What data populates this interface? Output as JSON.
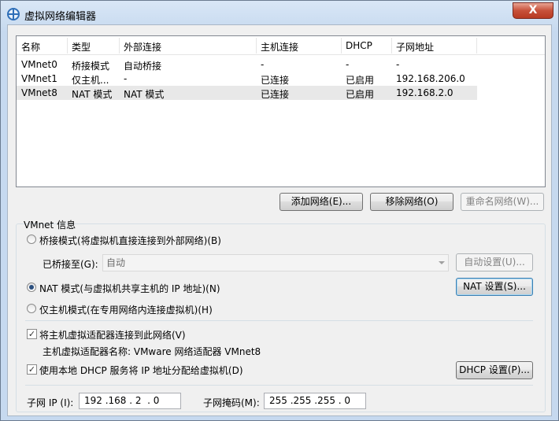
{
  "window": {
    "title": "虚拟网络编辑器",
    "close_label": "X"
  },
  "network_table": {
    "headers": [
      "名称",
      "类型",
      "外部连接",
      "主机连接",
      "DHCP",
      "子网地址"
    ],
    "rows": [
      [
        "VMnet0",
        "桥接模式",
        "自动桥接",
        "-",
        "-",
        "-"
      ],
      [
        "VMnet1",
        "仅主机...",
        "-",
        "已连接",
        "已启用",
        "192.168.206.0"
      ],
      [
        "VMnet8",
        "NAT 模式",
        "NAT 模式",
        "已连接",
        "已启用",
        "192.168.2.0"
      ]
    ],
    "selected_row": 2
  },
  "table_buttons": {
    "add": "添加网络(E)...",
    "remove": "移除网络(O)",
    "rename": "重命名网络(W)..."
  },
  "vmnet_info": {
    "group_label": "VMnet 信息",
    "bridge_radio": "桥接模式(将虚拟机直接连接到外部网络)(B)",
    "bridged_to_label": "已桥接至(G):",
    "bridged_to_value": "自动",
    "auto_settings": "自动设置(U)...",
    "nat_radio": "NAT 模式(与虚拟机共享主机的 IP 地址)(N)",
    "nat_settings": "NAT 设置(S)...",
    "hostonly_radio": "仅主机模式(在专用网络内连接虚拟机)(H)",
    "selected_mode": "nat",
    "connect_adapter_checkbox": "将主机虚拟适配器连接到此网络(V)",
    "connect_adapter_checked": true,
    "adapter_name": "主机虚拟适配器名称: VMware 网络适配器 VMnet8",
    "dhcp_checkbox": "使用本地 DHCP 服务将 IP 地址分配给虚拟机(D)",
    "dhcp_checked": true,
    "dhcp_settings": "DHCP 设置(P)...",
    "subnet_ip_label": "子网 IP (I):",
    "subnet_ip_value": "192 .168 . 2  . 0",
    "subnet_mask_label": "子网掩码(M):",
    "subnet_mask_value": "255 .255 .255 . 0"
  }
}
